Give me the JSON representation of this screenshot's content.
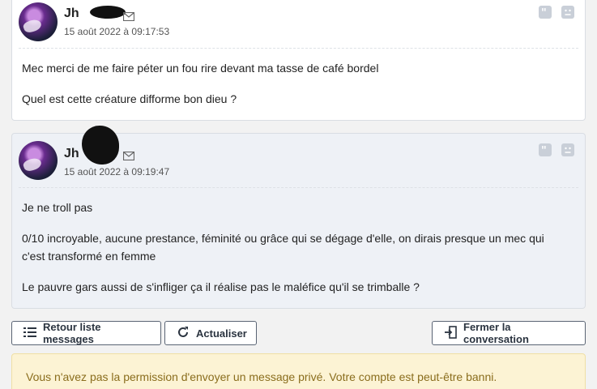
{
  "messages": [
    {
      "author": "Jh",
      "date": "15 août 2022 à 09:17:53",
      "paragraphs": [
        "Mec merci de me faire péter un fou rire devant ma tasse de café bordel",
        "Quel est cette créature difforme bon dieu ?"
      ]
    },
    {
      "author": "Jh",
      "date": "15 août 2022 à 09:19:47",
      "paragraphs": [
        "Je ne troll pas",
        "0/10 incroyable, aucune prestance, féminité ou grâce qui se dégage d'elle, on dirais presque un mec qui c'est transformé en femme",
        "Le pauvre gars aussi de s'infliger ça il réalise pas le maléfice qu'il se trimballe ?"
      ]
    }
  ],
  "actions": {
    "back_label": "Retour liste messages",
    "refresh_label": "Actualiser",
    "close_label": "Fermer la conversation"
  },
  "notice": "Vous n'avez pas la permission d'envoyer un message privé. Votre compte est peut-être banni.",
  "icons": {
    "mail": "envelope-icon",
    "quote": "quote-icon",
    "report": "report-icon",
    "back": "list-icon",
    "refresh": "refresh-icon",
    "close": "exit-icon"
  }
}
